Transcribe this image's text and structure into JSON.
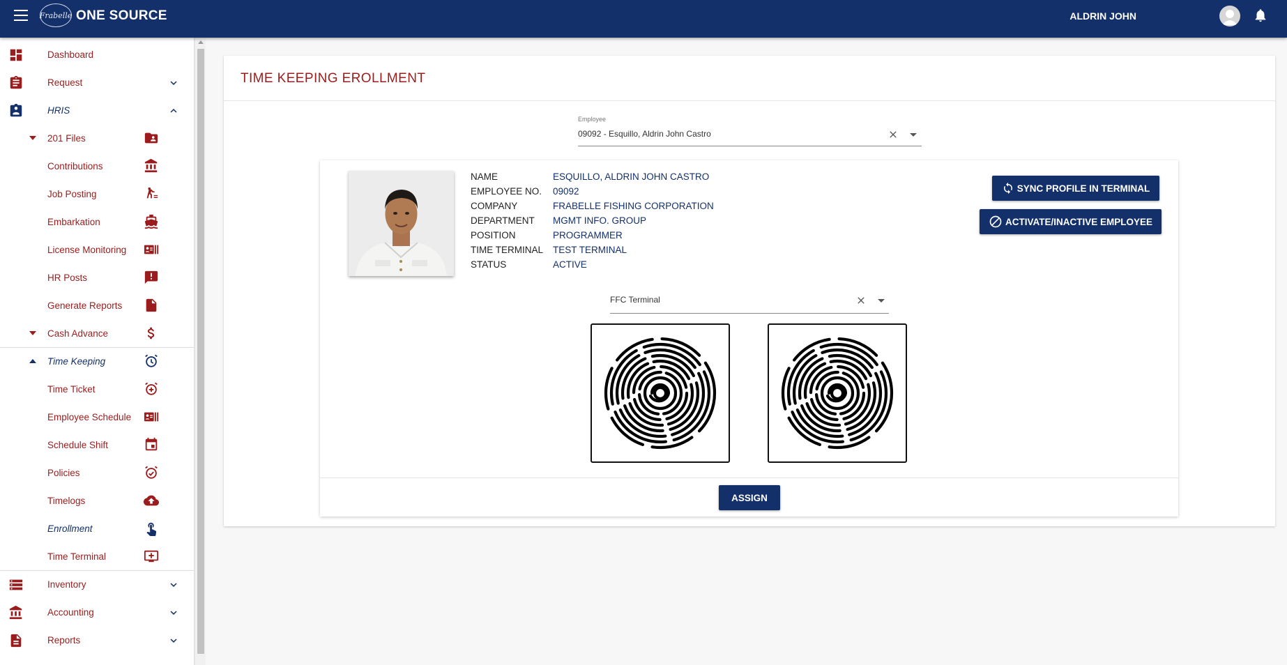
{
  "header": {
    "logo_text": "Frabelle",
    "app_title": "ONE SOURCE",
    "user_name": "ALDRIN JOHN",
    "brand_color": "#13306b"
  },
  "sidebar": {
    "dashboard": "Dashboard",
    "request": "Request",
    "hris": "HRIS",
    "files201": "201 Files",
    "contributions": "Contributions",
    "job_posting": "Job Posting",
    "embarkation": "Embarkation",
    "license_monitoring": "License Monitoring",
    "hr_posts": "HR Posts",
    "generate_reports": "Generate Reports",
    "cash_advance": "Cash Advance",
    "time_keeping": "Time Keeping",
    "time_ticket": "Time Ticket",
    "employee_schedule": "Employee Schedule",
    "schedule_shift": "Schedule Shift",
    "policies": "Policies",
    "timelogs": "Timelogs",
    "enrollment": "Enrollment",
    "time_terminal": "Time Terminal",
    "inventory": "Inventory",
    "accounting": "Accounting",
    "reports": "Reports"
  },
  "page": {
    "title": "TIME KEEPING EROLLMENT",
    "employee_label": "Employee",
    "employee_value": "09092 - Esquillo, Aldrin John Castro",
    "terminal_value": "FFC Terminal",
    "sync_button": "SYNC PROFILE IN TERMINAL",
    "activate_button": "ACTIVATE/INACTIVE EMPLOYEE",
    "assign_button": "ASSIGN"
  },
  "employee": {
    "name_label": "NAME",
    "name": "ESQUILLO, ALDRIN JOHN CASTRO",
    "no_label": "EMPLOYEE NO.",
    "no": "09092",
    "company_label": "COMPANY",
    "company": "FRABELLE FISHING CORPORATION",
    "department_label": "DEPARTMENT",
    "department": "MGMT INFO. GROUP",
    "position_label": "POSITION",
    "position": "PROGRAMMER",
    "terminal_label": "TIME TERMINAL",
    "terminal": "TEST TERMINAL",
    "status_label": "STATUS",
    "status": "ACTIVE"
  }
}
